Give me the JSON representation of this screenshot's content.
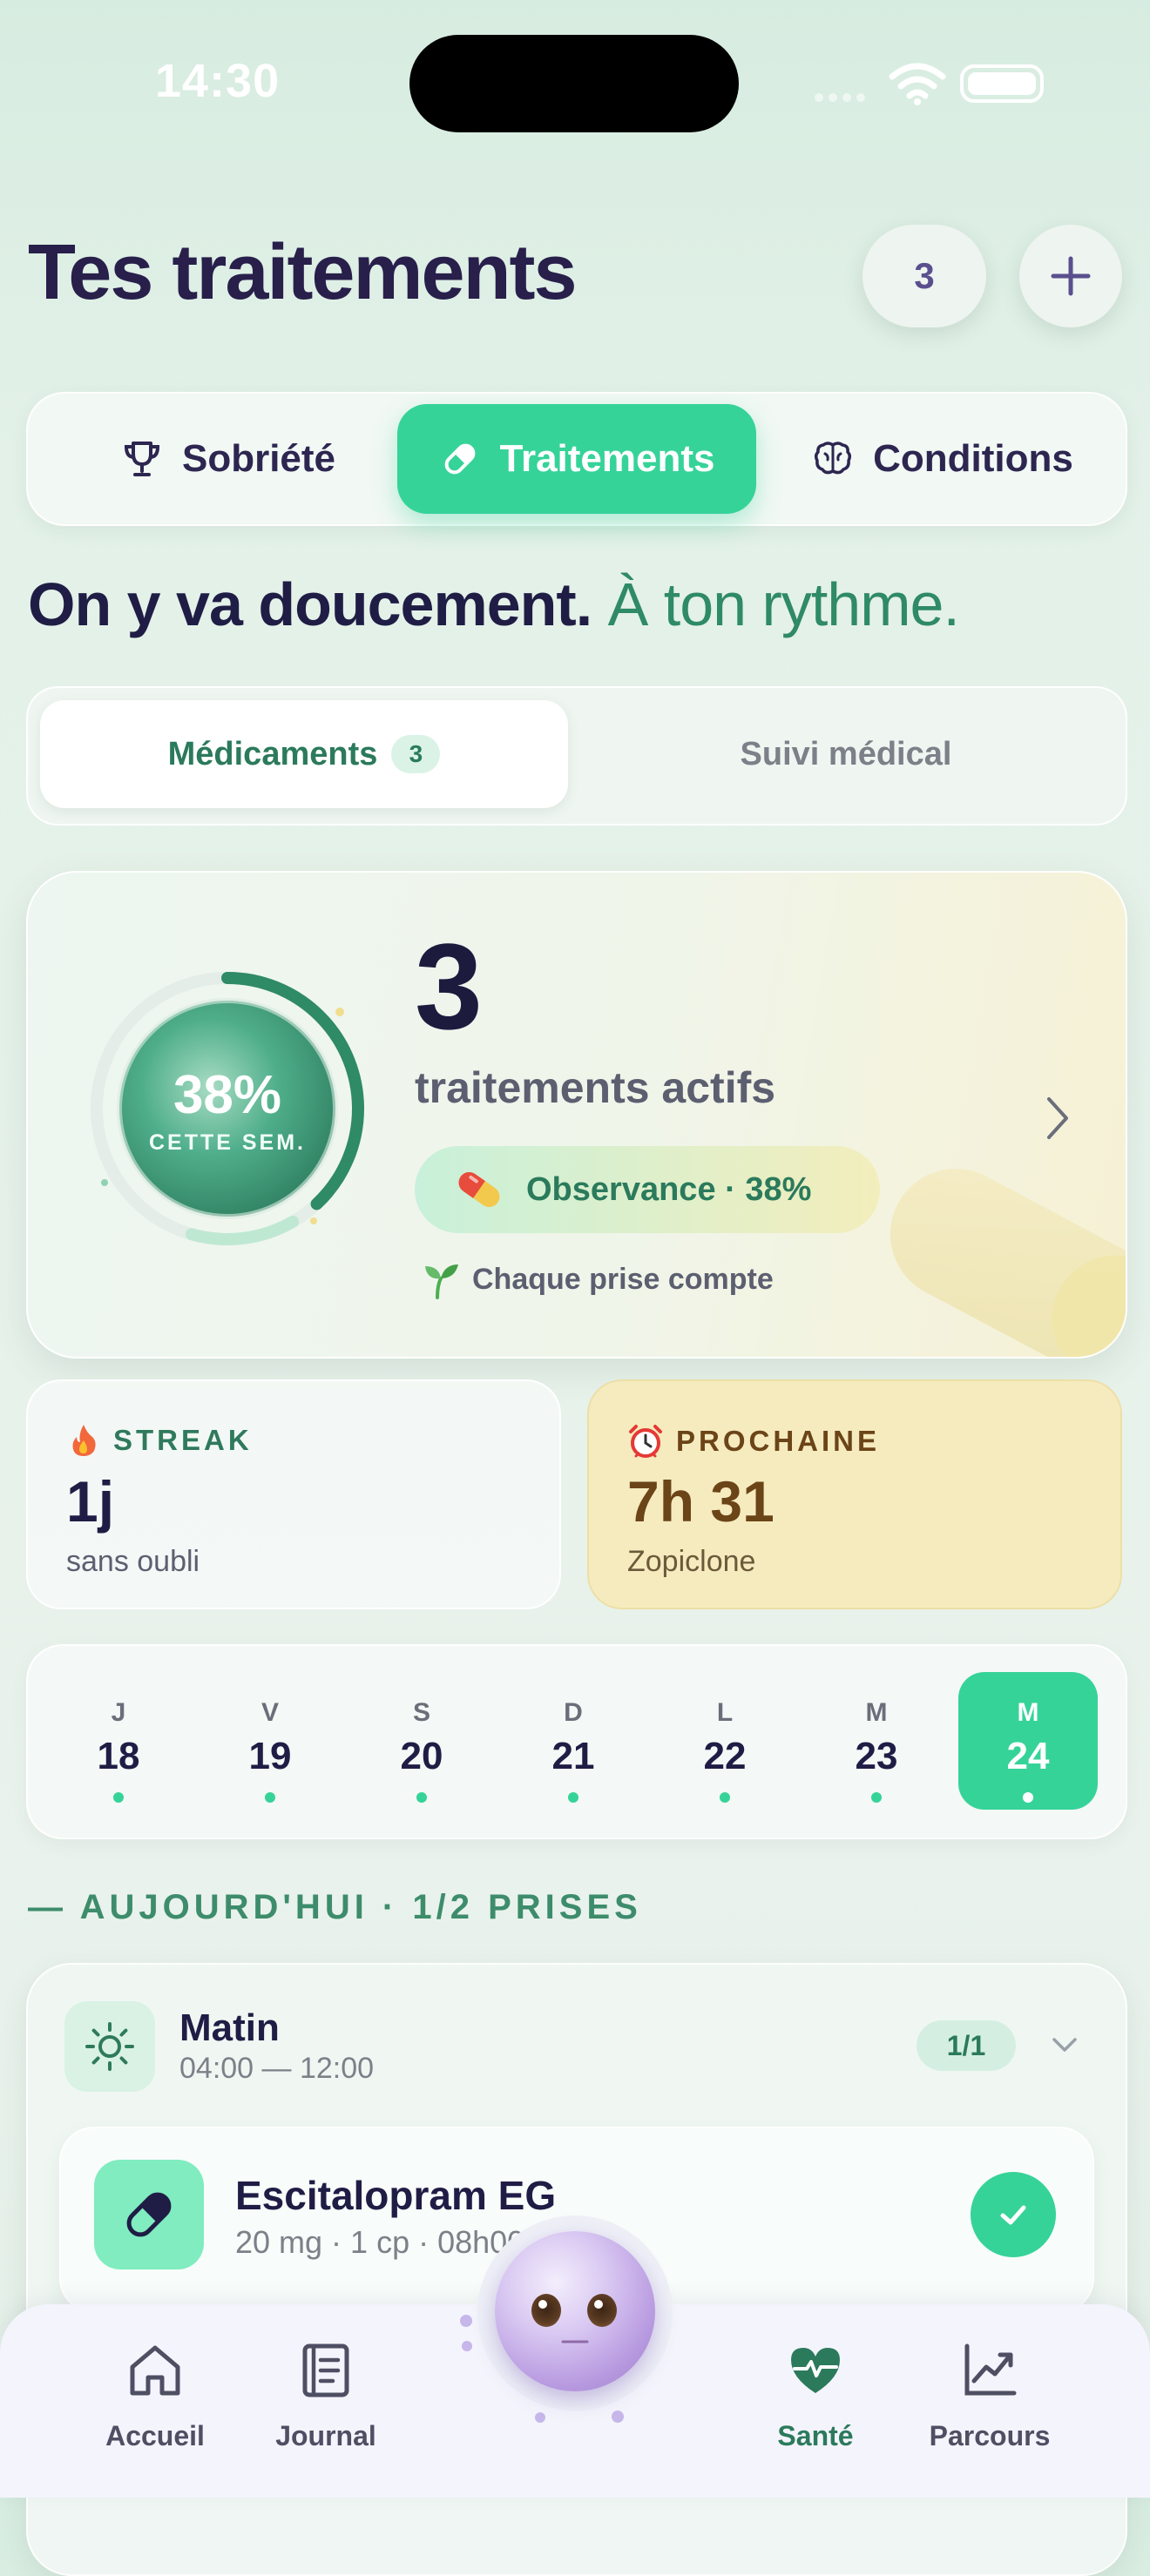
{
  "status_bar": {
    "time": "14:30"
  },
  "header": {
    "title": "Tes traitements",
    "count": "3"
  },
  "segments": [
    {
      "label": "Sobriété",
      "icon": "trophy-icon"
    },
    {
      "label": "Traitements",
      "icon": "pill-icon",
      "active": true
    },
    {
      "label": "Conditions",
      "icon": "brain-icon"
    }
  ],
  "tagline": {
    "bold": "On y va doucement.",
    "light": "À ton rythme."
  },
  "subtabs": {
    "medications": "Médicaments",
    "medications_count": "3",
    "followup": "Suivi médical"
  },
  "summary": {
    "ring_percent": "38%",
    "ring_percent_value": 0.38,
    "ring_label": "CETTE SEM.",
    "active_count": "3",
    "active_label": "traitements actifs",
    "observance": "Observance · 38%",
    "encouragement": "Chaque prise compte"
  },
  "stats": {
    "streak": {
      "label": "STREAK",
      "value": "1j",
      "sub": "sans oubli"
    },
    "next": {
      "label": "PROCHAINE",
      "value": "7h 31",
      "sub": "Zopiclone"
    }
  },
  "calendar": [
    {
      "letter": "J",
      "num": "18"
    },
    {
      "letter": "V",
      "num": "19"
    },
    {
      "letter": "S",
      "num": "20"
    },
    {
      "letter": "D",
      "num": "21"
    },
    {
      "letter": "L",
      "num": "22"
    },
    {
      "letter": "M",
      "num": "23"
    },
    {
      "letter": "M",
      "num": "24",
      "selected": true
    }
  ],
  "today": {
    "section_title": "— AUJOURD'HUI · 1/2 PRISES",
    "period": {
      "name": "Matin",
      "hours": "04:00 — 12:00",
      "ratio": "1/1"
    },
    "medication": {
      "name": "Escitalopram EG",
      "details": "20 mg · 1 cp · 08h00",
      "taken": true
    }
  },
  "nav": [
    {
      "label": "Accueil",
      "icon": "home-icon"
    },
    {
      "label": "Journal",
      "icon": "journal-icon"
    },
    {
      "label": "Santé",
      "icon": "heart-pulse-icon",
      "active": true
    },
    {
      "label": "Parcours",
      "icon": "chart-line-icon"
    }
  ],
  "colors": {
    "accent": "#36d399",
    "title": "#281f4b",
    "green_text": "#2b7a5c",
    "amber_card": "#f5ebbf",
    "amber_text": "#6b4417"
  }
}
